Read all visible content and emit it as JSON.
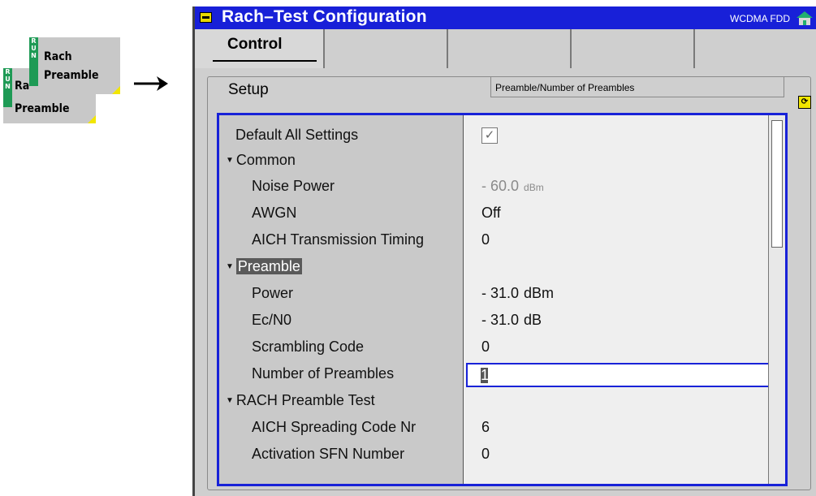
{
  "softkeys": {
    "back": {
      "run": [
        "R",
        "U",
        "N"
      ],
      "label_top": "Rach",
      "label_bottom": "Preamble"
    },
    "front": {
      "run": [
        "R",
        "U",
        "N"
      ],
      "label_top": "Rach",
      "label_bottom": "Preamble"
    }
  },
  "window": {
    "title": "Rach–Test Configuration",
    "mode": "WCDMA FDD"
  },
  "tabs": [
    {
      "label": "Control"
    },
    {
      "label": ""
    },
    {
      "label": ""
    },
    {
      "label": ""
    },
    {
      "label": ""
    }
  ],
  "setup": {
    "label": "Setup",
    "path": "Preamble/Number of Preambles"
  },
  "tree": {
    "default_all": {
      "label": "Default All Settings",
      "checked": true,
      "check_glyph": "✓"
    },
    "common": {
      "label": "Common",
      "noise_power": {
        "label": "Noise Power",
        "value": "- 60.0",
        "unit": "dBm"
      },
      "awgn": {
        "label": "AWGN",
        "value": "Off"
      },
      "aich_timing": {
        "label": "AICH Transmission Timing",
        "value": "0"
      }
    },
    "preamble": {
      "label": "Preamble",
      "power": {
        "label": "Power",
        "value": "- 31.0",
        "unit": "dBm"
      },
      "ec_n0": {
        "label": "Ec/N0",
        "value": "- 31.0",
        "unit": "dB"
      },
      "scrambling": {
        "label": "Scrambling Code",
        "value": "0"
      },
      "num_preambles": {
        "label": "Number of Preambles",
        "value": "1"
      }
    },
    "rach_test": {
      "label": "RACH Preamble Test",
      "aich_spreading": {
        "label": "AICH Spreading Code Nr",
        "value": "6"
      },
      "activation_sfn": {
        "label": "Activation SFN Number",
        "value": "0"
      }
    }
  },
  "colors": {
    "titlebar": "#1820d8",
    "focus_border": "#1822d8",
    "run_badge": "#1e9a55",
    "softkey_corner": "#f2e600"
  }
}
